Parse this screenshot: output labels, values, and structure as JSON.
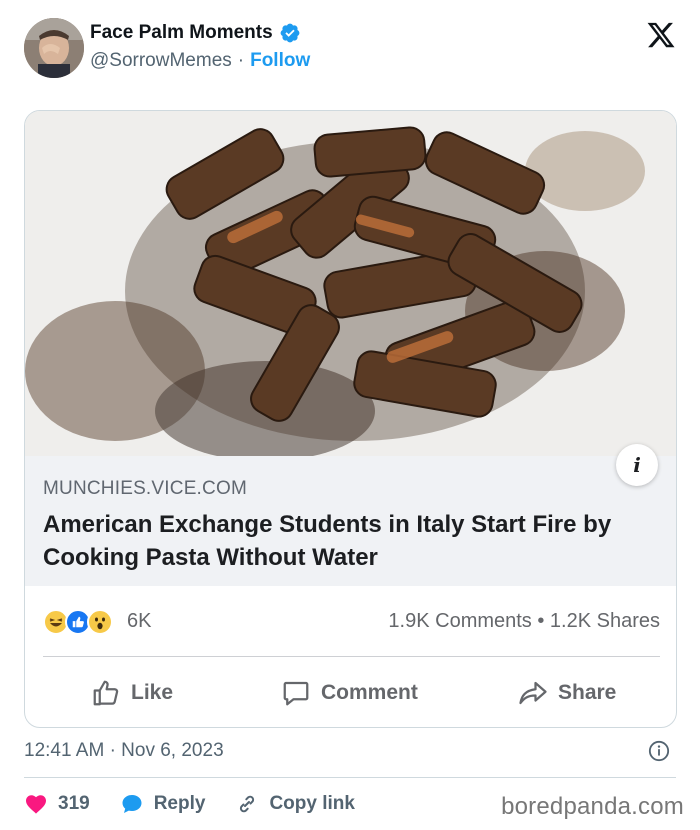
{
  "header": {
    "display_name": "Face Palm Moments",
    "handle": "@SorrowMemes",
    "separator": "·",
    "follow_label": "Follow",
    "icons": [
      "verified-badge-icon",
      "x-logo-icon"
    ]
  },
  "card": {
    "domain": "MUNCHIES.VICE.COM",
    "headline": "American Exchange Students in Italy Start Fire by Cooking Pasta Without Water",
    "info_glyph": "i",
    "reactions": {
      "icons": [
        "haha-emoji-icon",
        "like-reaction-icon",
        "wow-emoji-icon"
      ],
      "count": "6K"
    },
    "comments_shares": "1.9K Comments • 1.2K Shares",
    "actions": {
      "like": "Like",
      "comment": "Comment",
      "share": "Share"
    }
  },
  "meta": {
    "time": "12:41 AM",
    "separator": "·",
    "date": "Nov 6, 2023"
  },
  "engagement": {
    "likes": "319",
    "reply": "Reply",
    "copy_link": "Copy link"
  },
  "watermark": "boredpanda.com",
  "colors": {
    "accent": "#1d9bf0",
    "heart": "#f91880",
    "text": "#0f1419",
    "muted": "#536471",
    "preview_bg": "#f0f2f5"
  }
}
